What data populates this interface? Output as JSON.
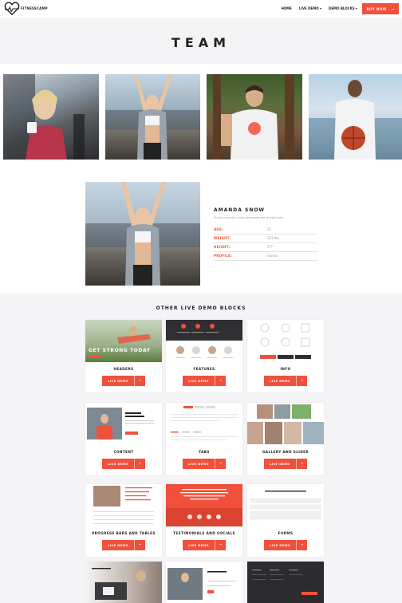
{
  "nav": {
    "brand": "FITNESSCAMP",
    "links": [
      "HOME",
      "LIVE DEMO ▾",
      "DEMO BLOCKS ▾"
    ],
    "buy_label": "BUY NOW",
    "buy_arrow": "→"
  },
  "team": {
    "title": "TEAM"
  },
  "member": {
    "name": "AMANDA SNOW",
    "description": "Fitness instructor. Loves lightweight and strength work.",
    "rows": [
      {
        "label": "AGE:",
        "value": "22"
      },
      {
        "label": "WEIGHT:",
        "value": "123 lbs"
      },
      {
        "label": "HEIGHT:",
        "value": "5'7\""
      },
      {
        "label": "PROFILE:",
        "value": "Cardio"
      }
    ]
  },
  "other": {
    "title": "OTHER LIVE DEMO BLOCKS",
    "button_label": "LIVE DEMO",
    "button_arrow": "→",
    "hero_text": "GET STRONG TODAY",
    "cards": [
      {
        "label": "HEADERS"
      },
      {
        "label": "FEATURES"
      },
      {
        "label": "INFO"
      },
      {
        "label": "CONTENT"
      },
      {
        "label": "TABS"
      },
      {
        "label": "GALLERY AND SLIDER"
      },
      {
        "label": "PROGRESS BARS AND TABLES"
      },
      {
        "label": "TESTIMONIALS AND SOCIALS"
      },
      {
        "label": "FORMS"
      }
    ]
  },
  "colors": {
    "accent": "#f1503b",
    "background": "#f4f3f6",
    "text": "#222222"
  }
}
